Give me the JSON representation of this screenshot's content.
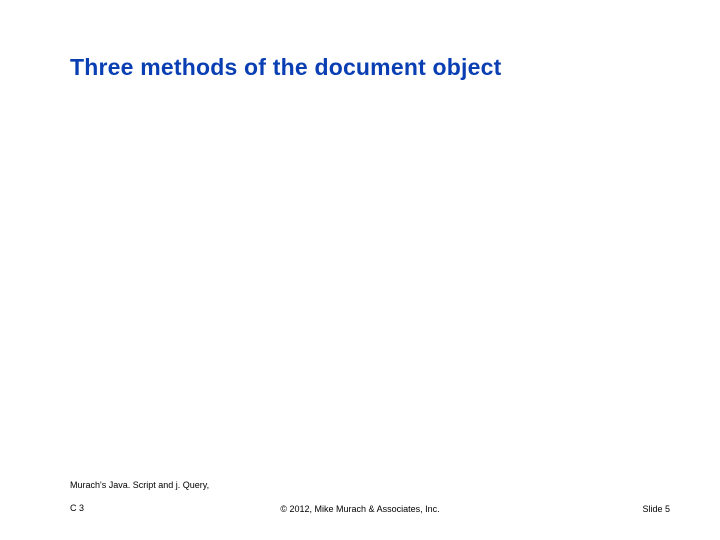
{
  "title": "Three methods of the document object",
  "footer": {
    "left_line1": "Murach's Java. Script and j. Query,",
    "left_line2": "C 3",
    "center": "© 2012, Mike Murach & Associates, Inc.",
    "right": "Slide 5"
  }
}
